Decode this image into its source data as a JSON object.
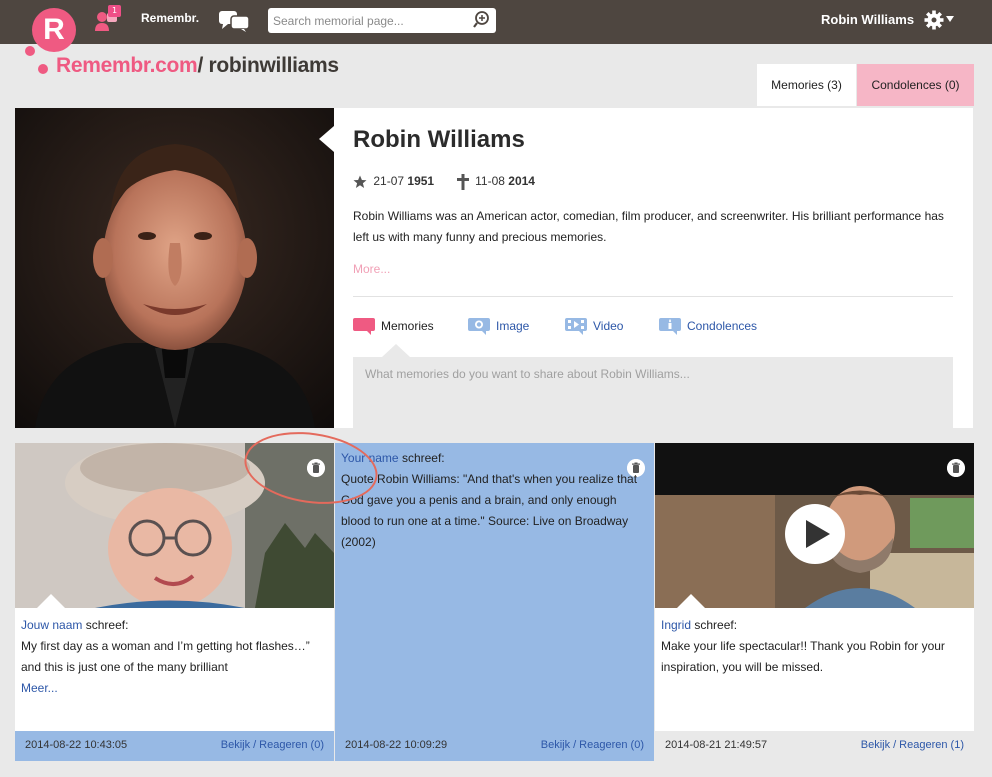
{
  "header": {
    "notification_count": "1",
    "brand": "Remembr.",
    "search_placeholder": "Search memorial page...",
    "user_name": "Robin Williams"
  },
  "logo": {
    "letter": "R",
    "site": "Remembr.com",
    "slug": "/ robinwilliams"
  },
  "tabs": {
    "memories": "Memories (3)",
    "condolences": "Condolences (0)"
  },
  "profile": {
    "name": "Robin Williams",
    "birth_day": "21-07",
    "birth_year": "1951",
    "death_day": "11-08",
    "death_year": "2014",
    "bio": "Robin Williams was an American actor, comedian, film producer, and screenwriter. His brilliant performance has left us with many funny and precious memories.",
    "more": "More...",
    "post_tabs": {
      "memories": "Memories",
      "image": "Image",
      "video": "Video",
      "condolences": "Condolences"
    },
    "share_placeholder": "What memories do you want to share about Robin Williams..."
  },
  "cards": [
    {
      "author": "Jouw naam",
      "wrote": "schreef:",
      "text": "My first day as a woman and I’m getting hot flashes…” and this is just one of the many brilliant",
      "more": "Meer...",
      "timestamp": "2014-08-22 10:43:05",
      "view": "Bekijk",
      "reply": "Reageren (0)"
    },
    {
      "author": "Your name",
      "wrote": "schreef:",
      "text": "Quote Robin Williams: \"And that's when you realize that God gave you a penis and a brain, and only enough blood to run one at a time.\" Source: Live on Broadway (2002)",
      "timestamp": "2014-08-22 10:09:29",
      "view": "Bekijk",
      "reply": "Reageren (0)"
    },
    {
      "author": "Ingrid",
      "wrote": "schreef:",
      "text": "Make your life spectacular!! Thank you Robin for your inspiration, you will be missed.",
      "timestamp": "2014-08-21 21:49:57",
      "view": "Bekijk",
      "reply": "Reageren (1)"
    }
  ],
  "colors": {
    "topbar": "#4e4640",
    "brand_pink": "#ef5a82",
    "card_blue": "#97b9e4",
    "link_blue": "#2d57a8"
  }
}
